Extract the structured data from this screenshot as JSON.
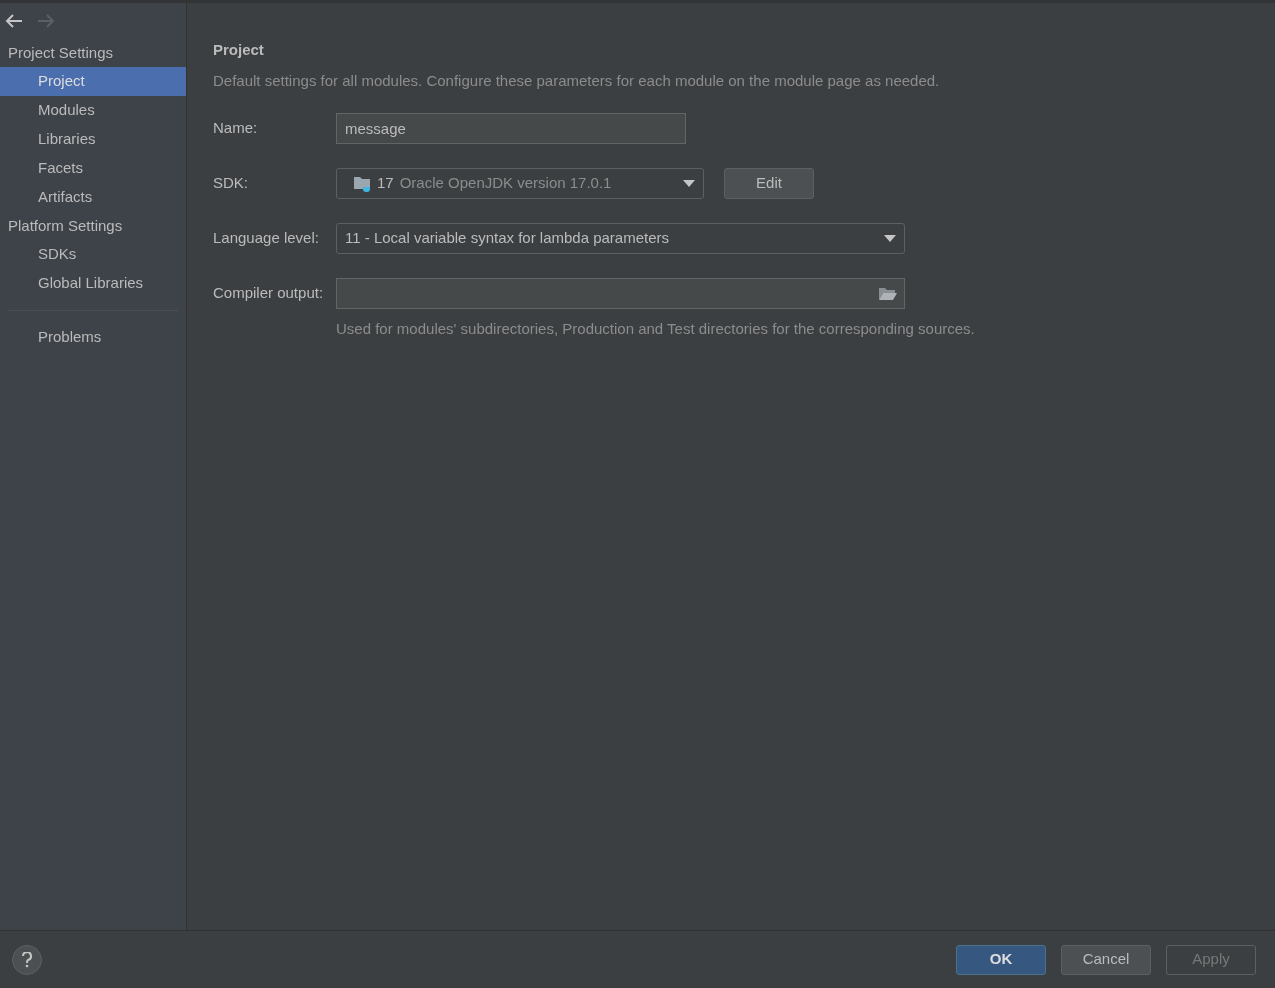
{
  "nav": [
    {
      "kind": "back",
      "disabled": false
    },
    {
      "kind": "forward",
      "disabled": true
    }
  ],
  "sidebar": {
    "sections": [
      {
        "title": "Project Settings",
        "items": [
          {
            "label": "Project",
            "selected": true
          },
          {
            "label": "Modules",
            "selected": false
          },
          {
            "label": "Libraries",
            "selected": false
          },
          {
            "label": "Facets",
            "selected": false
          },
          {
            "label": "Artifacts",
            "selected": false
          }
        ]
      },
      {
        "title": "Platform Settings",
        "items": [
          {
            "label": "SDKs",
            "selected": false
          },
          {
            "label": "Global Libraries",
            "selected": false
          }
        ]
      }
    ],
    "footer_items": [
      {
        "label": "Problems",
        "selected": false
      }
    ]
  },
  "panel": {
    "title": "Project",
    "description": "Default settings for all modules. Configure these parameters for each module on the module page as needed.",
    "fields": [
      {
        "kind": "text",
        "label": "Name:",
        "value": "message"
      },
      {
        "kind": "sdk",
        "label": "SDK:",
        "version": "17",
        "value": "Oracle OpenJDK version 17.0.1",
        "button": "Edit"
      },
      {
        "kind": "select",
        "label": "Language level:",
        "value": "11 - Local variable syntax for lambda parameters"
      },
      {
        "kind": "folder",
        "label": "Compiler output:",
        "hint": "Used for modules' subdirectories, Production and Test directories for the corresponding sources."
      }
    ]
  },
  "buttons": [
    {
      "label": "OK",
      "default": true,
      "disabled": false
    },
    {
      "label": "Cancel",
      "default": false,
      "disabled": false
    },
    {
      "label": "Apply",
      "default": false,
      "disabled": true
    }
  ]
}
